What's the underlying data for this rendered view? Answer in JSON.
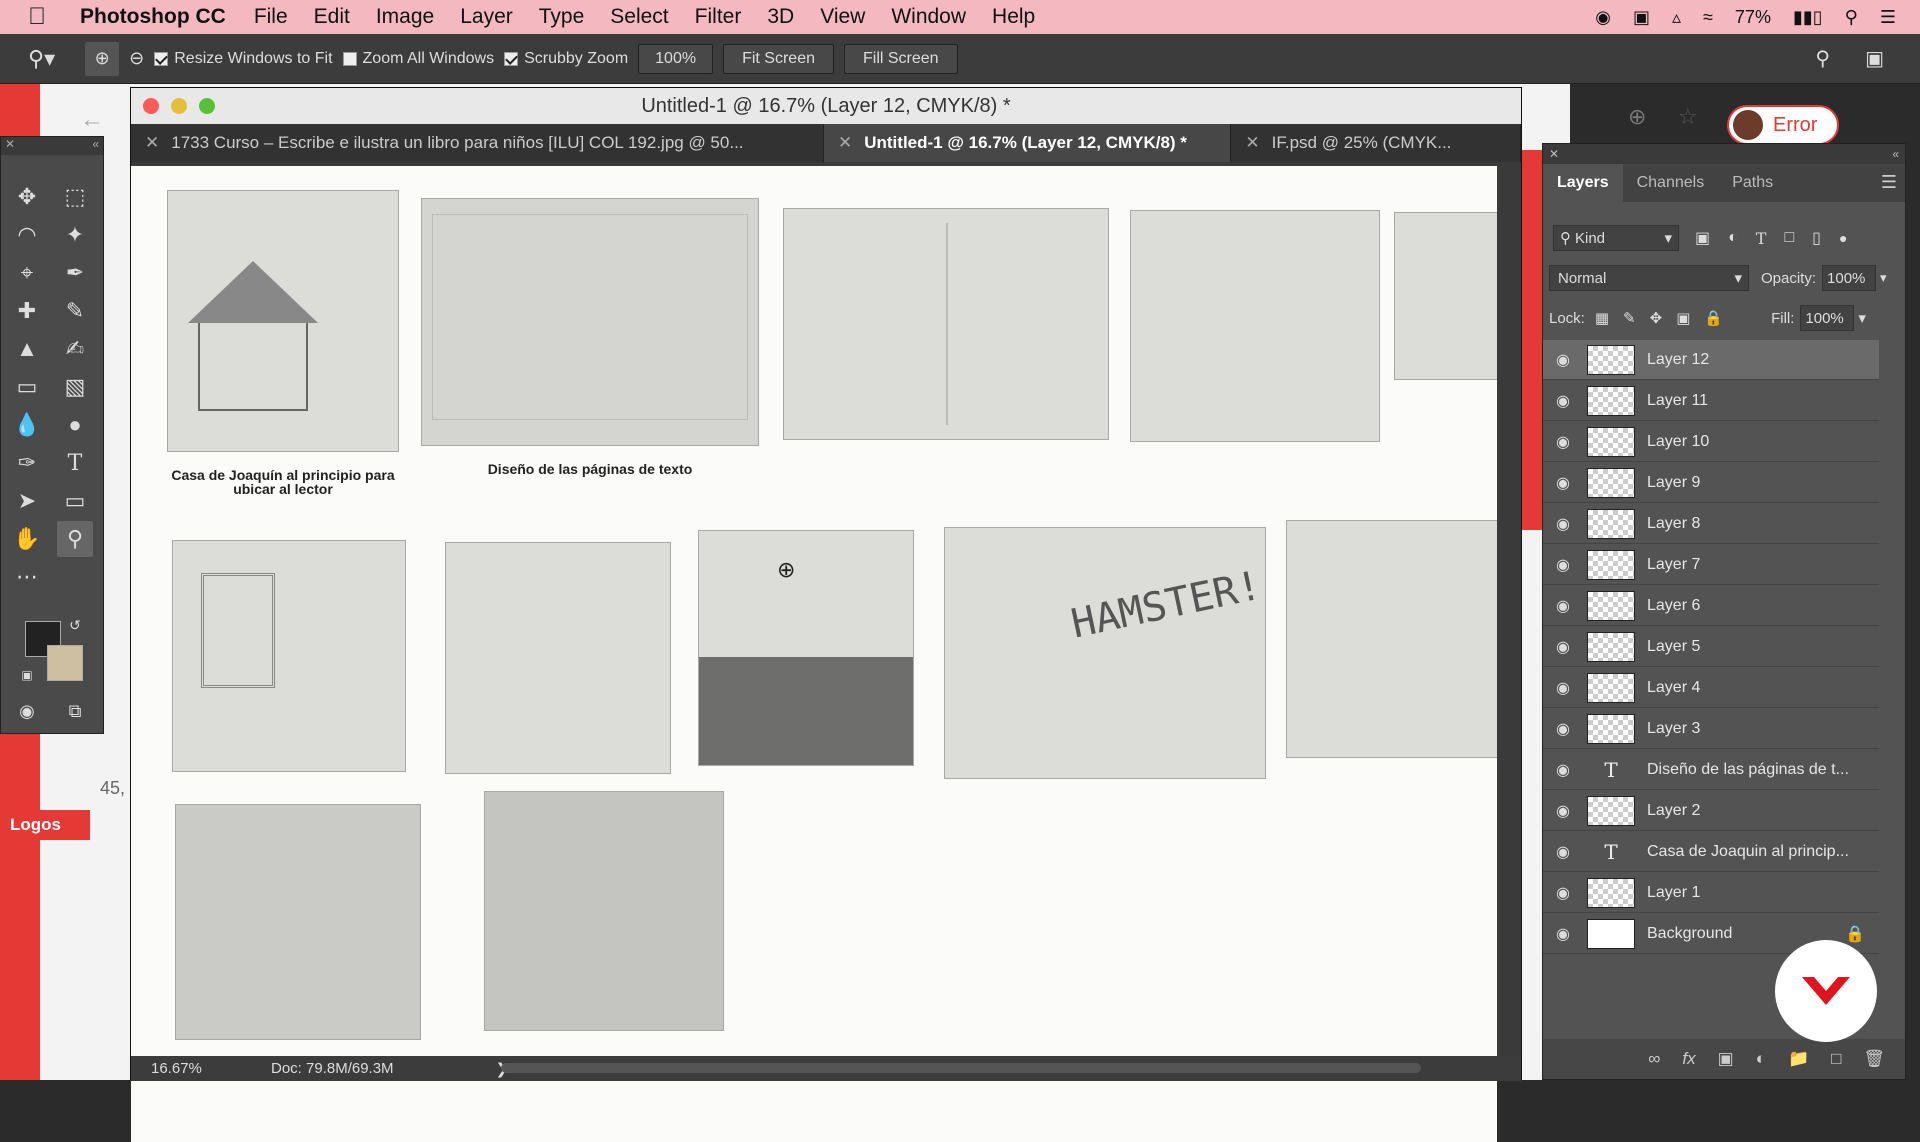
{
  "menubar": {
    "app": "Photoshop CC",
    "items": [
      "File",
      "Edit",
      "Image",
      "Layer",
      "Type",
      "Select",
      "Filter",
      "3D",
      "View",
      "Window",
      "Help"
    ],
    "battery": "77%"
  },
  "options": {
    "resize_windows": "Resize Windows to Fit",
    "zoom_all": "Zoom All Windows",
    "scrubby": "Scrubby Zoom",
    "zoom_value": "100%",
    "fit_screen": "Fit Screen",
    "fill_screen": "Fill Screen"
  },
  "document": {
    "title": "Untitled-1 @ 16.7% (Layer 12, CMYK/8) *",
    "tabs": [
      "1733 Curso – Escribe e ilustra un libro para niños [ILU] COL 192.jpg @ 50...",
      "Untitled-1 @ 16.7% (Layer 12, CMYK/8) *",
      "IF.psd @ 25% (CMYK..."
    ],
    "captions": [
      "Casa de Joaquín al principio para ubicar al lector",
      "Diseño de las páginas de texto"
    ],
    "sketch_text": "HAMSTER!",
    "zoom": "16.67%",
    "doc_size": "Doc: 79.8M/69.3M"
  },
  "browser": {
    "error_label": "Error",
    "side_text": "Logos",
    "side_number": "45,"
  },
  "layers_panel": {
    "tabs": [
      "Layers",
      "Channels",
      "Paths"
    ],
    "kind": "Kind",
    "blend_mode": "Normal",
    "opacity_label": "Opacity:",
    "opacity_value": "100%",
    "lock_label": "Lock:",
    "fill_label": "Fill:",
    "fill_value": "100%",
    "layers": [
      {
        "name": "Layer 12",
        "type": "pixel"
      },
      {
        "name": "Layer 11",
        "type": "pixel"
      },
      {
        "name": "Layer 10",
        "type": "pixel"
      },
      {
        "name": "Layer 9",
        "type": "pixel"
      },
      {
        "name": "Layer 8",
        "type": "pixel"
      },
      {
        "name": "Layer 7",
        "type": "pixel"
      },
      {
        "name": "Layer 6",
        "type": "pixel"
      },
      {
        "name": "Layer 5",
        "type": "pixel"
      },
      {
        "name": "Layer 4",
        "type": "pixel"
      },
      {
        "name": "Layer 3",
        "type": "pixel"
      },
      {
        "name": "Diseño de las páginas de t...",
        "type": "text"
      },
      {
        "name": "Layer 2",
        "type": "pixel"
      },
      {
        "name": "Casa de Joaquin al princip...",
        "type": "text"
      },
      {
        "name": "Layer 1",
        "type": "pixel"
      },
      {
        "name": "Background",
        "type": "background"
      }
    ]
  },
  "colors": {
    "menubar": "#f4b9c0",
    "accent_red": "#e53935",
    "panel": "#535353"
  }
}
